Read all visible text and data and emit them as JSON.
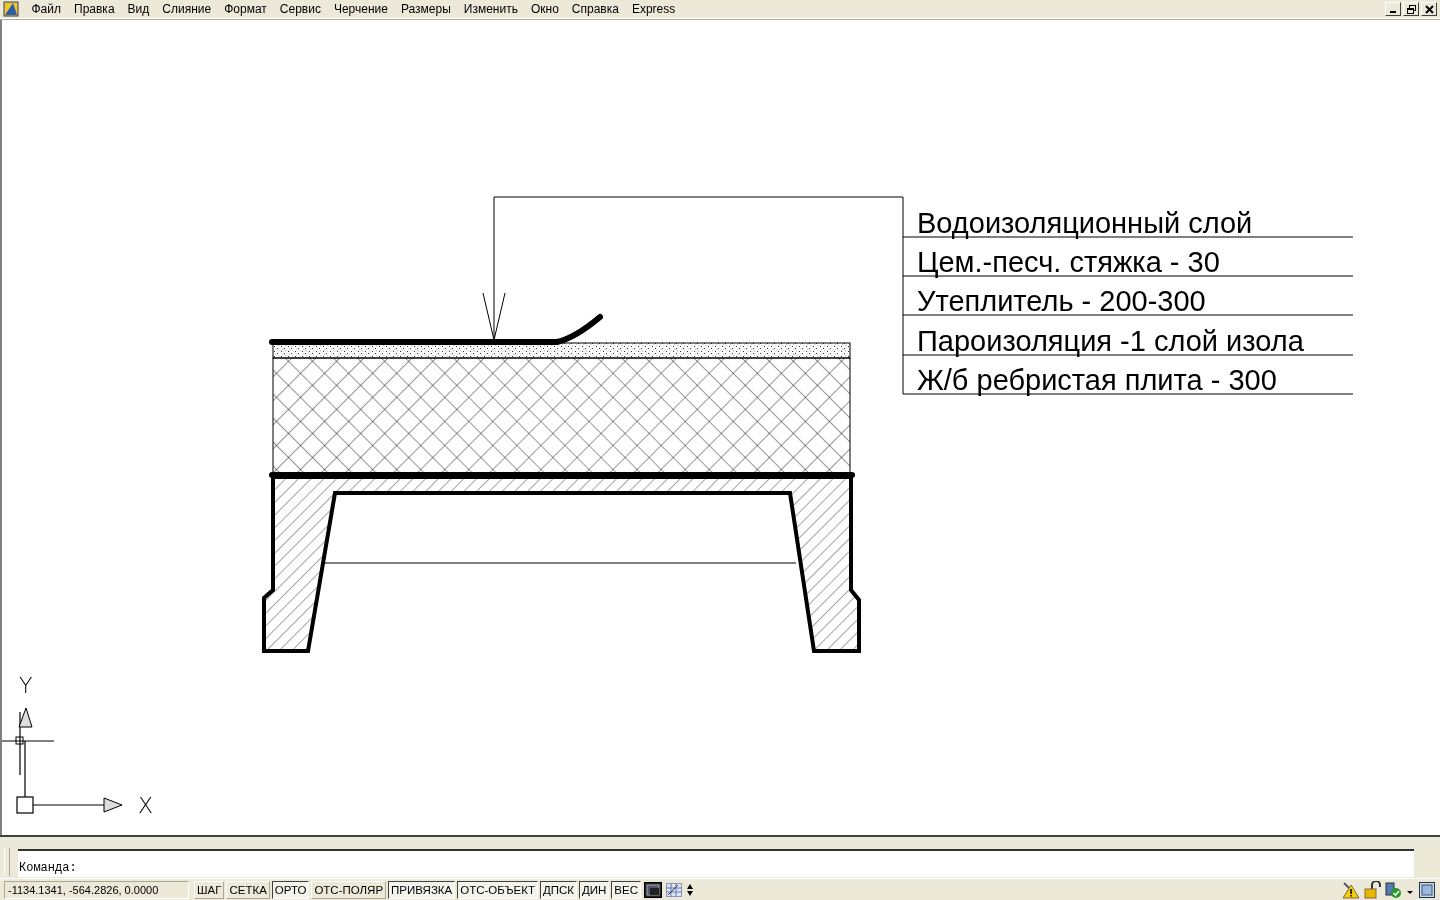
{
  "menu_bar": {
    "items": [
      "Файл",
      "Правка",
      "Вид",
      "Слияние",
      "Формат",
      "Сервис",
      "Черчение",
      "Размеры",
      "Изменить",
      "Окно",
      "Справка",
      "Express"
    ]
  },
  "drawing": {
    "layer_labels": [
      "Водоизоляционный слой",
      "Цем.-песч. стяжка - 30",
      "Утеплитель - 200-300",
      "Пароизоляция -1 слой изола",
      "Ж/б ребристая плита - 300"
    ]
  },
  "ucs": {
    "x_label": "X",
    "y_label": "Y"
  },
  "command_line": {
    "prompt": "Команда:"
  },
  "status_bar": {
    "coordinates": "-1134.1341, -564.2826, 0.0000",
    "toggles": [
      {
        "label": "ШАГ",
        "on": false
      },
      {
        "label": "СЕТКА",
        "on": false
      },
      {
        "label": "ОРТО",
        "on": true
      },
      {
        "label": "ОТС-ПОЛЯР",
        "on": false
      },
      {
        "label": "ПРИВЯЗКА",
        "on": true
      },
      {
        "label": "ОТС-ОБЪЕКТ",
        "on": true
      },
      {
        "label": "ДПСК",
        "on": true
      },
      {
        "label": "ДИН",
        "on": true
      },
      {
        "label": "ВЕС",
        "on": true
      }
    ]
  }
}
